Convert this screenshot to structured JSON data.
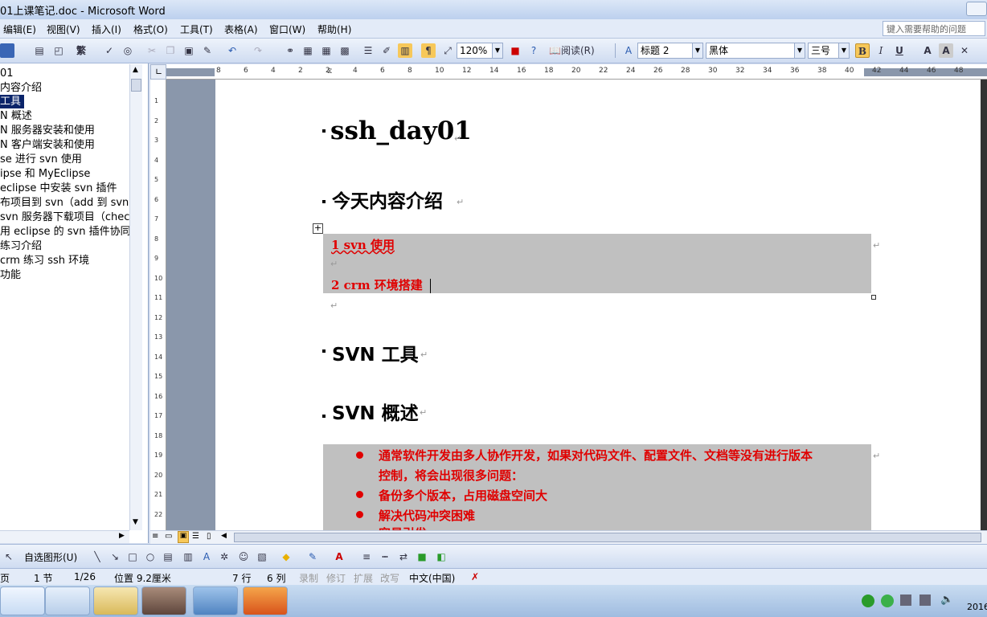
{
  "window": {
    "title": "01上课笔记.doc - Microsoft Word"
  },
  "menu": {
    "items": [
      "编辑(E)",
      "视图(V)",
      "插入(I)",
      "格式(O)",
      "工具(T)",
      "表格(A)",
      "窗口(W)",
      "帮助(H)"
    ],
    "help_placeholder": "键入需要帮助的问题"
  },
  "toolbar": {
    "zoom": "120%",
    "read_label": "阅读(R)",
    "style": "标题 2",
    "font": "黑体",
    "size": "三号",
    "bold_label": "B",
    "italic_label": "I",
    "underline_label": "U",
    "trad_label": "繁"
  },
  "docmap": {
    "items": [
      "01",
      "内容介绍",
      "工具",
      "N 概述",
      "N 服务器安装和使用",
      "N 客户端安装和使用",
      "se 进行 svn 使用",
      "ipse 和 MyEclipse",
      "eclipse 中安装 svn 插件",
      "布项目到 svn（add 到 svn）",
      "svn 服务器下载项目（chec",
      "用 eclipse 的 svn 插件协同开",
      " 练习介绍",
      " crm 练习 ssh 环境",
      "功能"
    ],
    "selected_index": 2
  },
  "ruler": {
    "h_labels": [
      "8",
      "6",
      "4",
      "2",
      "2",
      "4",
      "6",
      "8",
      "10",
      "12",
      "14",
      "16",
      "18",
      "20",
      "22",
      "24",
      "26",
      "28",
      "30",
      "32",
      "34",
      "36",
      "38",
      "40",
      "42",
      "44",
      "46",
      "48"
    ],
    "v_labels": [
      "1",
      "2",
      "3",
      "4",
      "5",
      "6",
      "7",
      "8",
      "9",
      "10",
      "11",
      "12",
      "13",
      "14",
      "15",
      "16",
      "17",
      "18",
      "19",
      "20",
      "21",
      "22"
    ]
  },
  "document": {
    "title": "ssh_day01",
    "heading_intro": "今天内容介绍",
    "intro_item1": "1 svn 使用",
    "intro_item2": "2 crm 环境搭建",
    "heading_svn_tool": "SVN 工具",
    "heading_svn_overview": "SVN 概述",
    "bullet1_line1": "通常软件开发由多人协作开发，如果对代码文件、配置文件、文档等没有进行版本",
    "bullet1_line2": "控制，将会出现很多问题：",
    "bullet2": "备份多个版本，占用磁盘空间大",
    "bullet3": "解决代码冲突困难",
    "bullet4_partial": "容易引发",
    "para_mark": "↵"
  },
  "drawbar": {
    "autoshapes": "自选图形(U)"
  },
  "status": {
    "page": "页",
    "section": "1 节",
    "pages": "1/26",
    "position": "位置 9.2厘米",
    "line": "7 行",
    "col": "6 列",
    "rec": "录制",
    "trk": "修订",
    "ext": "扩展",
    "ovr": "改写",
    "lang": "中文(中国)"
  },
  "taskbar": {
    "clock": "2016"
  },
  "colors": {
    "accent": "#0a246a",
    "red_text": "#e00000",
    "shade": "#c0c0c0"
  }
}
